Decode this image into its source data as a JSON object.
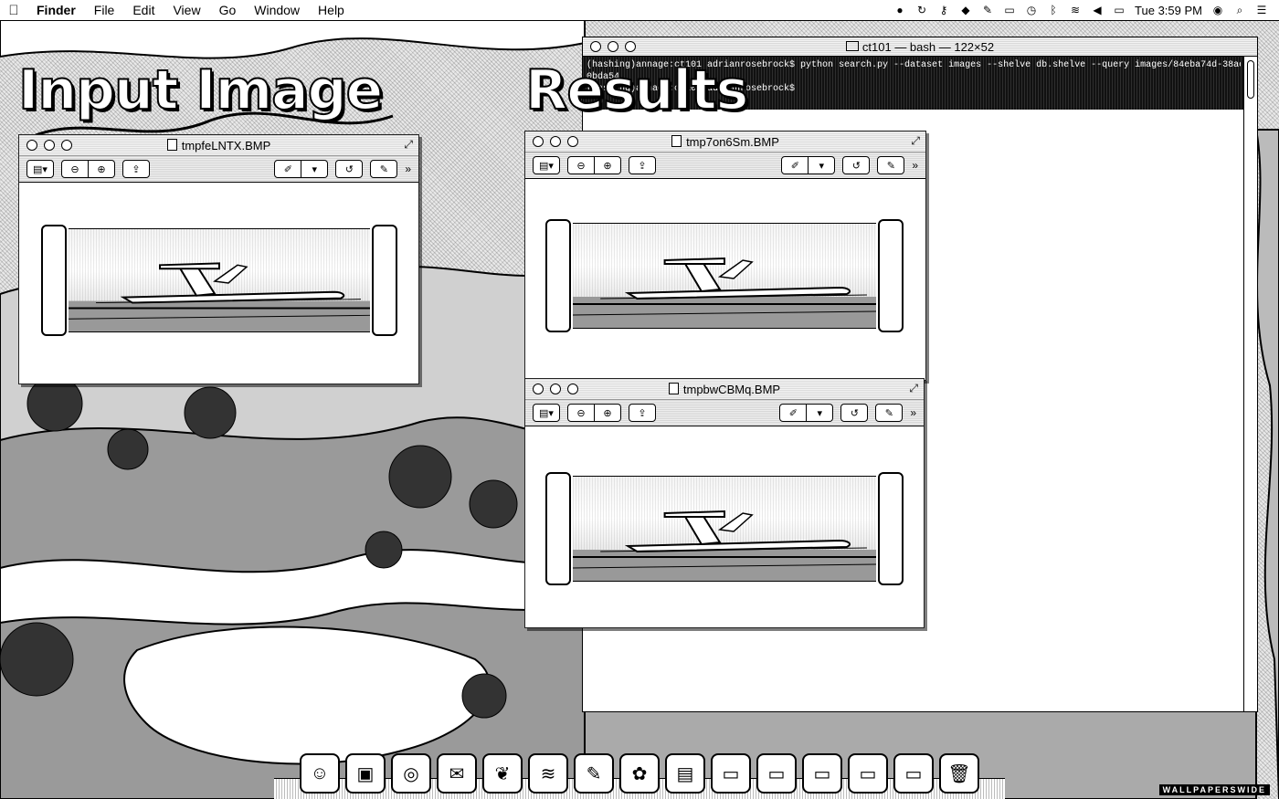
{
  "menubar": {
    "app_name": "Finder",
    "items": [
      "File",
      "Edit",
      "View",
      "Go",
      "Window",
      "Help"
    ],
    "clock": "Tue 3:59 PM"
  },
  "overlay": {
    "input_title": "Input Image",
    "results_title": "Results"
  },
  "windows": {
    "input": {
      "title": "tmpfeLNTX.BMP"
    },
    "result1": {
      "title": "tmp7on6Sm.BMP"
    },
    "result2": {
      "title": "tmpbwCBMq.BMP"
    }
  },
  "terminal": {
    "title": "ct101 — bash — 122×52",
    "lines": [
      "(hashing)annage:ct101 adrianrosebrock$ python search.py --dataset images --shelve db.shelve --query images/84eba74d-38ae",
      "0bda54",
      "(hashing)annage:ct101 adrianrosebrock$ "
    ]
  },
  "dock": {
    "apps": [
      "finder-icon",
      "preview-icon",
      "chrome-icon",
      "mail-icon",
      "evernote-icon",
      "spotify-icon",
      "notes-icon",
      "photos-icon",
      "terminal-icon",
      "window-icon",
      "window-icon",
      "window-icon",
      "window-icon",
      "window-icon",
      "window-icon",
      "window-icon",
      "trash-icon"
    ]
  },
  "watermark": "WALLPAPERSWIDE"
}
